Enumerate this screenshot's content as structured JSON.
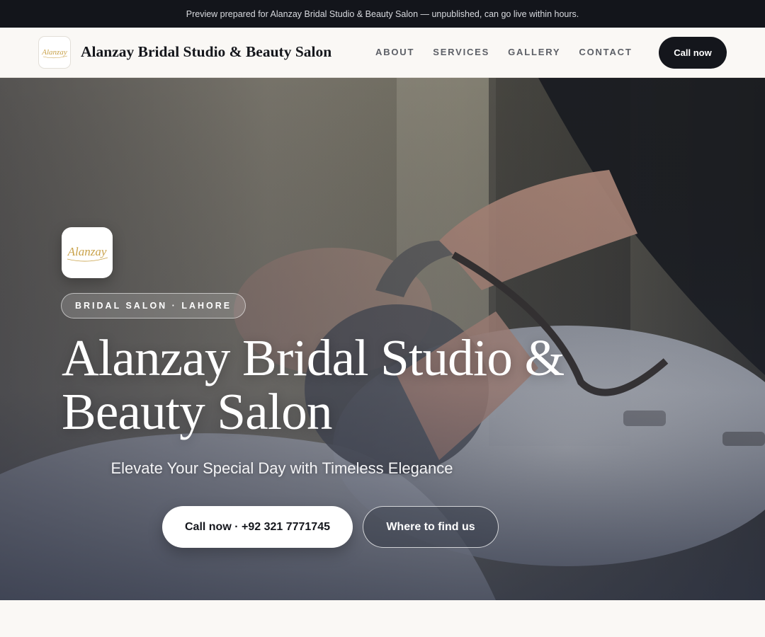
{
  "preview_bar": {
    "text": "Preview prepared for Alanzay Bridal Studio & Beauty Salon — unpublished, can go live within hours."
  },
  "header": {
    "logo_text": "Alanzay",
    "brand_name": "Alanzay Bridal Studio & Beauty Salon",
    "nav": [
      {
        "label": "ABOUT"
      },
      {
        "label": "SERVICES"
      },
      {
        "label": "GALLERY"
      },
      {
        "label": "CONTACT"
      }
    ],
    "cta_label": "Call now"
  },
  "hero": {
    "logo_text": "Alanzay",
    "badge": "BRIDAL SALON · LAHORE",
    "title": "Alanzay Bridal Studio & Beauty Salon",
    "subtitle": "Elevate Your Special Day with Timeless Elegance",
    "primary_button": "Call now · +92 321 7771745",
    "secondary_button": "Where to find us"
  },
  "colors": {
    "dark": "#14161c",
    "page_background": "#faf8f5",
    "logo_gold": "#c9a24a"
  },
  "icons": {
    "logo": "alanzay-script-logo"
  }
}
